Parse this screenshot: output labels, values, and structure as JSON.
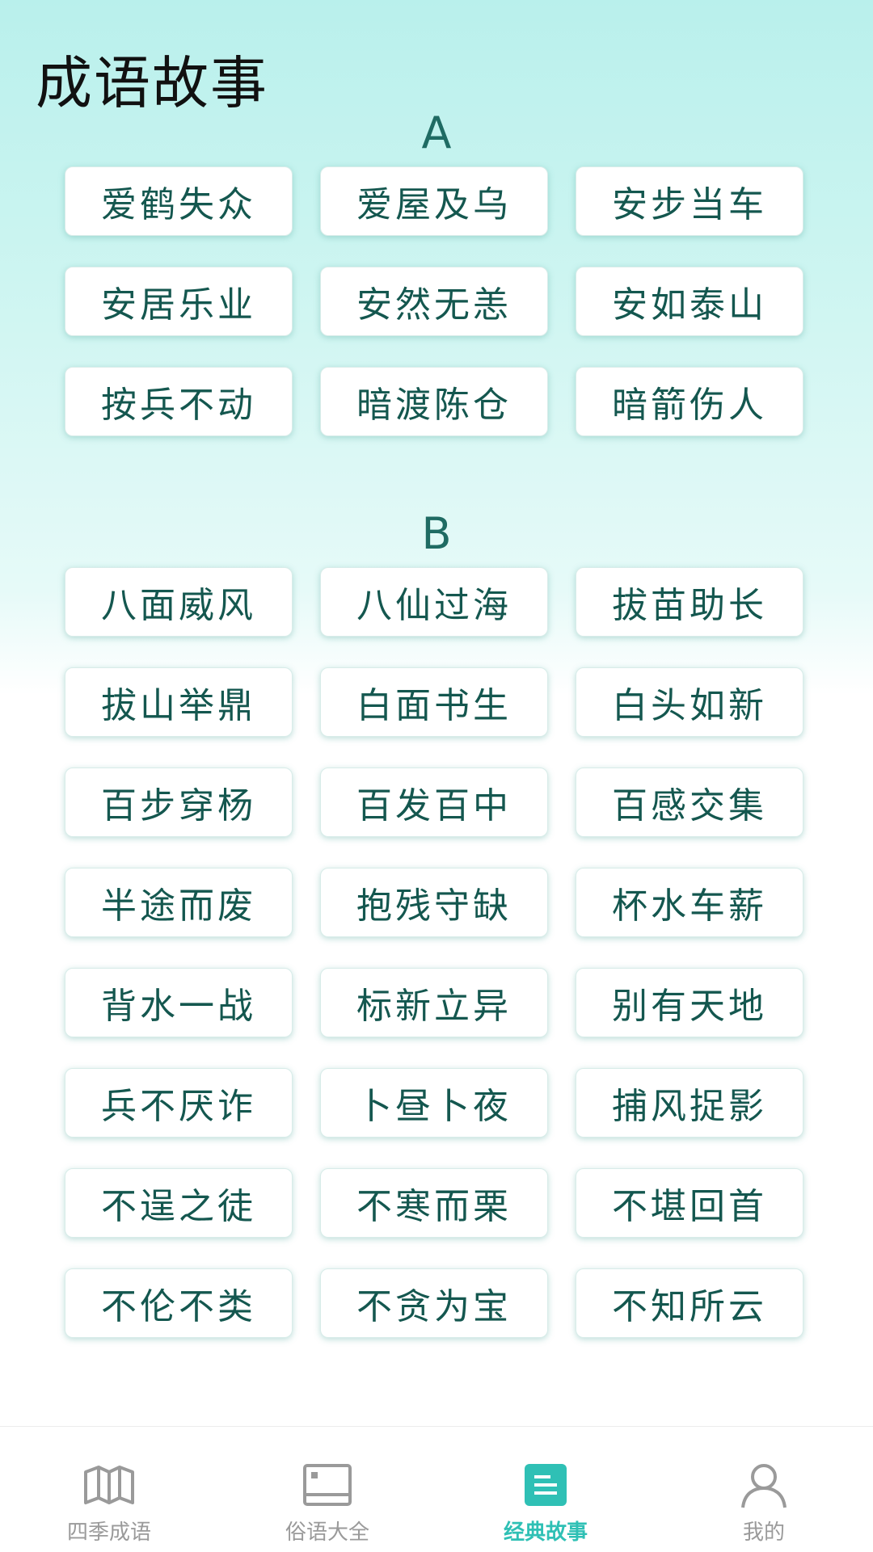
{
  "header": {
    "title": "成语故事"
  },
  "sections": [
    {
      "letter": "A",
      "items": [
        "爱鹤失众",
        "爱屋及乌",
        "安步当车",
        "安居乐业",
        "安然无恙",
        "安如泰山",
        "按兵不动",
        "暗渡陈仓",
        "暗箭伤人"
      ]
    },
    {
      "letter": "B",
      "items": [
        "八面威风",
        "八仙过海",
        "拔苗助长",
        "拔山举鼎",
        "白面书生",
        "白头如新",
        "百步穿杨",
        "百发百中",
        "百感交集",
        "半途而废",
        "抱残守缺",
        "杯水车薪",
        "背水一战",
        "标新立异",
        "别有天地",
        "兵不厌诈",
        "卜昼卜夜",
        "捕风捉影",
        "不逞之徒",
        "不寒而栗",
        "不堪回首",
        "不伦不类",
        "不贪为宝",
        "不知所云"
      ]
    }
  ],
  "tabbar": {
    "tabs": [
      {
        "label": "四季成语",
        "icon": "map-book-icon",
        "active": false
      },
      {
        "label": "俗语大全",
        "icon": "picture-frame-icon",
        "active": false
      },
      {
        "label": "经典故事",
        "icon": "document-list-icon",
        "active": true
      },
      {
        "label": "我的",
        "icon": "user-icon",
        "active": false
      }
    ]
  },
  "colors": {
    "accent": "#2fc0b5",
    "chip_text": "#14574f",
    "inactive": "#9a9a9a"
  }
}
